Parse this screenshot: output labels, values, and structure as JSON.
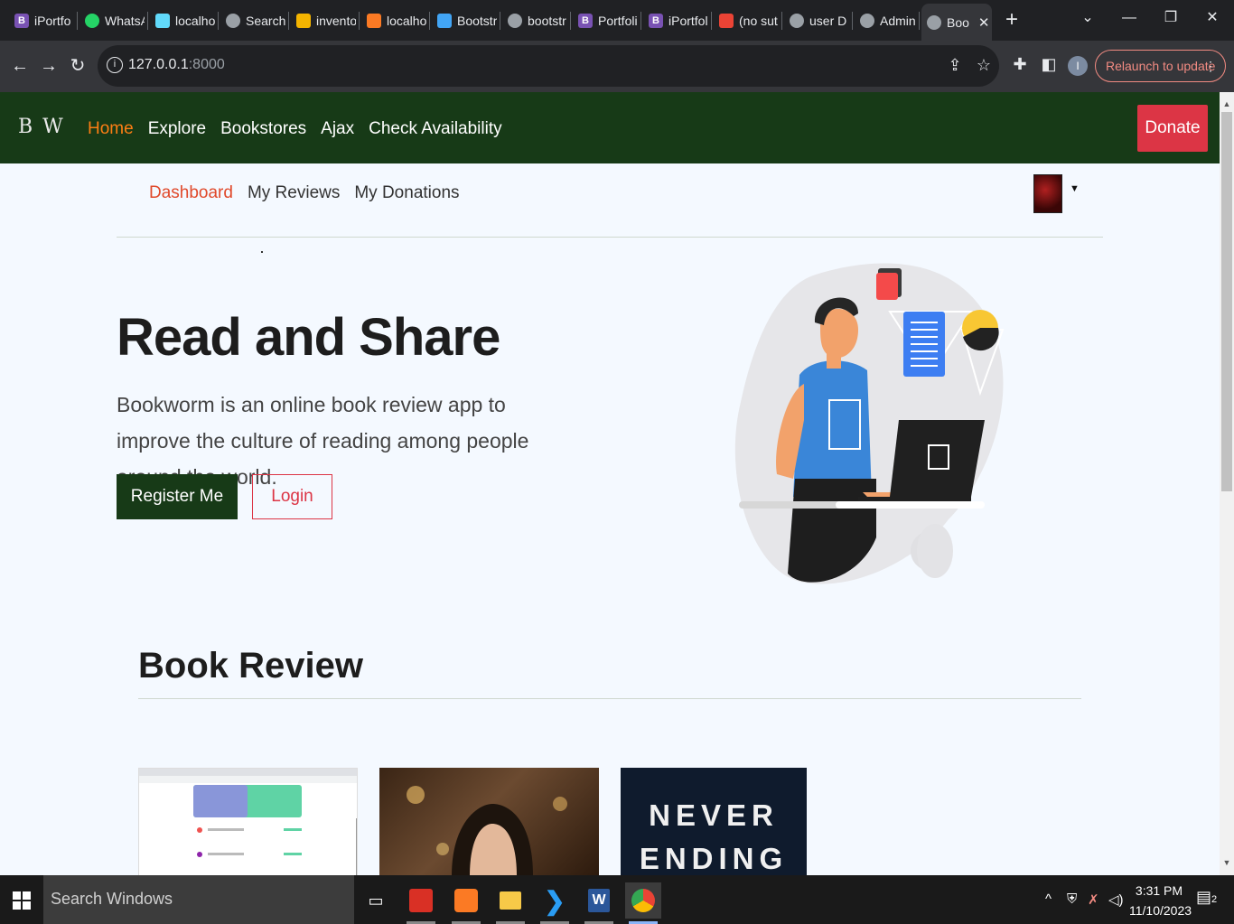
{
  "browser": {
    "tabs": [
      {
        "label": "iPortfo",
        "icon": "bootstrap-icon",
        "color": "#7952b3"
      },
      {
        "label": "WhatsA",
        "icon": "whatsapp-icon",
        "color": "#25d366"
      },
      {
        "label": "localho",
        "icon": "react-icon",
        "color": "#61dafb"
      },
      {
        "label": "Search",
        "icon": "globe-icon",
        "color": "#9aa0a6"
      },
      {
        "label": "invento",
        "icon": "drive-icon",
        "color": "#f4b400"
      },
      {
        "label": "localho",
        "icon": "xampp-icon",
        "color": "#fb7a24"
      },
      {
        "label": "Bootstr",
        "icon": "flutter-icon",
        "color": "#42a5f5"
      },
      {
        "label": "bootstr",
        "icon": "globe-icon",
        "color": "#9aa0a6"
      },
      {
        "label": "Portfoli",
        "icon": "bootstrap-icon",
        "color": "#7952b3"
      },
      {
        "label": "iPortfol",
        "icon": "bootstrap-icon",
        "color": "#7952b3"
      },
      {
        "label": "(no sut",
        "icon": "gmail-icon",
        "color": "#ea4335"
      },
      {
        "label": "user D",
        "icon": "globe-icon",
        "color": "#9aa0a6"
      },
      {
        "label": "Admin",
        "icon": "globe-icon",
        "color": "#9aa0a6"
      },
      {
        "label": "Boo",
        "icon": "globe-icon",
        "color": "#9aa0a6",
        "active": true
      }
    ],
    "url_host": "127.0.0.1",
    "url_port": ":8000",
    "relaunch_label": "Relaunch to update",
    "profile_initial": "I"
  },
  "site": {
    "logo": "B W",
    "nav": [
      "Home",
      "Explore",
      "Bookstores",
      "Ajax",
      "Check Availability"
    ],
    "donate_label": "Donate",
    "subnav": [
      "Dashboard",
      "My Reviews",
      "My Donations"
    ]
  },
  "hero": {
    "title": "Read and Share",
    "text": "Bookworm is an online book review app to improve the culture of reading among people around the world.",
    "register_label": "Register Me",
    "login_label": "Login"
  },
  "reviews": {
    "title": "Book Review",
    "card3_line1": "NEVER",
    "card3_line2": "ENDING"
  },
  "taskbar": {
    "search_placeholder": "Search Windows",
    "time": "3:31 PM",
    "date": "11/10/2023",
    "notifications": "2"
  },
  "colors": {
    "brand_green": "#173a17",
    "accent_orange": "#fd7e14",
    "danger_red": "#dc3545"
  }
}
